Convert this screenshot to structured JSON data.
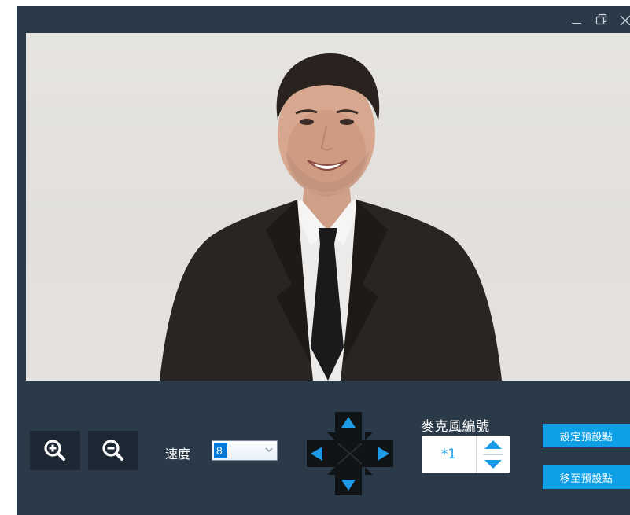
{
  "window": {
    "controls": {
      "minimize_icon": "minimize-icon",
      "restore_icon": "restore-icon"
    }
  },
  "video": {
    "icon": "live-camera-feed"
  },
  "zoom": {
    "in_icon": "zoom-in-icon",
    "out_icon": "zoom-out-icon"
  },
  "speed": {
    "label": "速度",
    "value": "8"
  },
  "ptz": {
    "up_icon": "arrow-up-icon",
    "down_icon": "arrow-down-icon",
    "left_icon": "arrow-left-icon",
    "right_icon": "arrow-right-icon"
  },
  "mic": {
    "label": "麥克風編號",
    "value": "*1"
  },
  "preset": {
    "set_label": "設定預設點",
    "goto_label": "移至預設點"
  },
  "colors": {
    "window_bg": "#2b3a48",
    "accent": "#0ea0e6",
    "arrow_blue": "#1e9be6",
    "button_bg": "#1d2834"
  }
}
